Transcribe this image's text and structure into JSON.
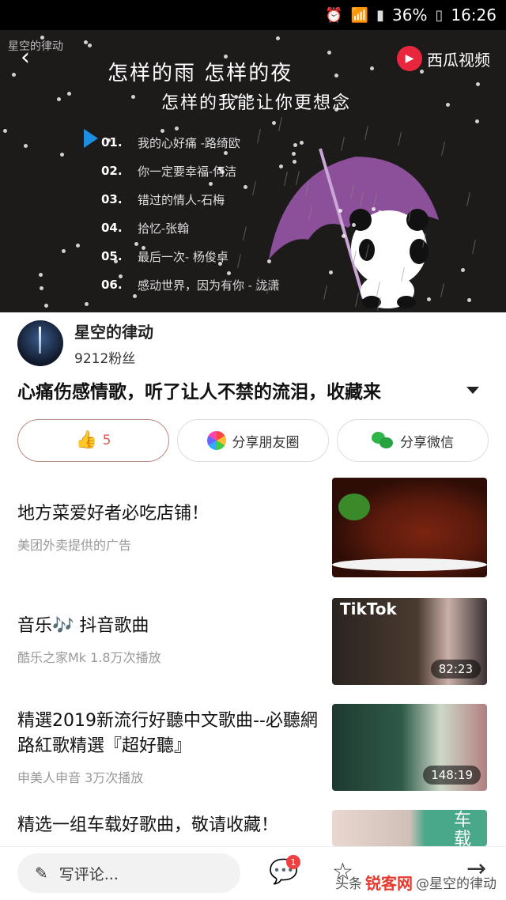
{
  "status_bar": {
    "battery": "36%",
    "time": "16:26"
  },
  "video": {
    "channel_watermark": "星空的律动",
    "brand": "西瓜视频",
    "line1": "怎样的雨 怎样的夜",
    "line2": "怎样的我能让你更想念",
    "tracks": [
      {
        "num": "01.",
        "song": "我的心好痛 -路绮欧"
      },
      {
        "num": "02.",
        "song": "你一定要幸福-何洁"
      },
      {
        "num": "03.",
        "song": "错过的情人-石梅"
      },
      {
        "num": "04.",
        "song": "拾忆-张翰"
      },
      {
        "num": "05.",
        "song": "最后一次- 杨俊卓"
      },
      {
        "num": "06.",
        "song": "感动世界，因为有你 - 泷潇"
      }
    ]
  },
  "author": {
    "name": "星空的律动",
    "fans": "9212粉丝"
  },
  "title": "心痛伤感情歌，听了让人不禁的流泪，收藏来",
  "actions": {
    "like_count": "5",
    "share_moments": "分享朋友圈",
    "share_wechat": "分享微信"
  },
  "feed": [
    {
      "title": "地方菜爱好者必吃店铺！",
      "meta": "美团外卖提供的广告",
      "duration": ""
    },
    {
      "title": "音乐🎶 抖音歌曲",
      "meta": "酷乐之家Mk   1.8万次播放",
      "duration": "82:23",
      "thumb_text": "TikTok"
    },
    {
      "title": "精選2019新流行好聽中文歌曲--必聽網路紅歌精選『超好聽』",
      "meta": "申美人申音   3万次播放",
      "duration": "148:19"
    },
    {
      "title": "精选一组车载好歌曲，敬请收藏！",
      "meta": "",
      "duration": "",
      "thumb_text": "车载"
    }
  ],
  "bottom_bar": {
    "comment_placeholder": "写评论...",
    "comment_badge": "1"
  },
  "watermark": {
    "prefix": "头条",
    "logo": "锐客网",
    "suffix": "@星空的律动"
  }
}
